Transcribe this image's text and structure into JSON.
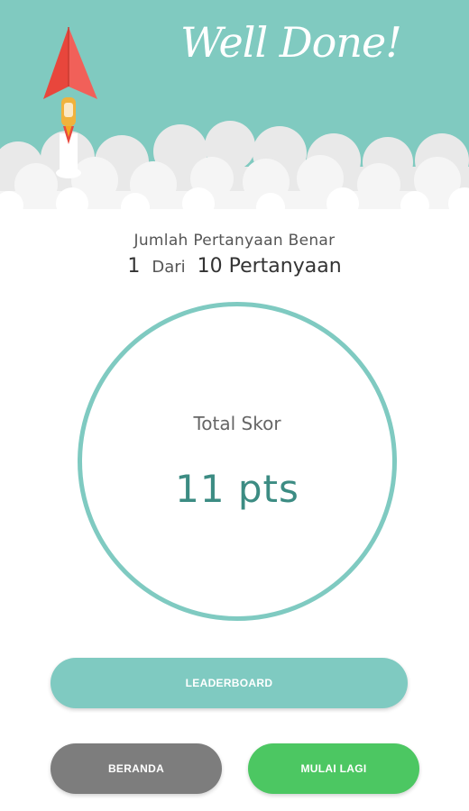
{
  "header": {
    "title": "Well Done!",
    "background_color": "#80cac0",
    "illustration": "paper-plane-rocket-icon"
  },
  "result": {
    "correct_label": "Jumlah Pertanyaan Benar",
    "correct_count": "1",
    "of_label": "Dari",
    "total_questions": "10 Pertanyaan",
    "score_label": "Total Skor",
    "score_value": "11  pts"
  },
  "buttons": {
    "leaderboard": "LEADERBOARD",
    "home": "BERANDA",
    "restart": "MULAI LAGI"
  },
  "colors": {
    "accent": "#7fcac1",
    "score_text": "#3c8c83",
    "home_button": "#7d7d7d",
    "restart_button": "#4cc762"
  }
}
